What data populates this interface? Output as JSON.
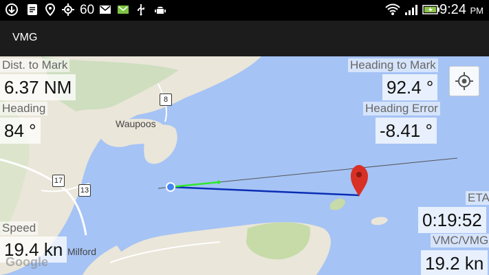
{
  "status_bar": {
    "notification_count": "60",
    "time": "9:24",
    "ampm": "PM",
    "icons": [
      "download-icon",
      "notes-icon",
      "location-off-icon",
      "gps-icon",
      "gmail-icon",
      "envelope-icon",
      "usb-icon",
      "android-debug-icon",
      "wifi-icon",
      "signal-icon",
      "battery-charging-icon"
    ]
  },
  "action_bar": {
    "title": "VMG"
  },
  "map": {
    "places": {
      "waupoos": "Waupoos",
      "milford": "Milford"
    },
    "shields": {
      "r8": "8",
      "r17": "17",
      "r13": "13"
    },
    "attribution": "Google",
    "marker_color": "#d93025",
    "course_color": "#0a2db5",
    "heading_color": "#2ee82a"
  },
  "overlays": {
    "dist_label": "Dist. to Mark",
    "dist_value": "6.37 NM",
    "heading_label": "Heading",
    "heading_value": "84 °",
    "speed_label": "Speed",
    "speed_value": "19.4 kn",
    "heading_to_mark_label": "Heading to Mark",
    "heading_to_mark_value": "92.4 °",
    "heading_error_label": "Heading Error",
    "heading_error_value": "-8.41 °",
    "eta_label": "ETA",
    "eta_value": "0:19:52",
    "vmc_label": "VMC/VMG",
    "vmc_value": "19.2 kn"
  }
}
